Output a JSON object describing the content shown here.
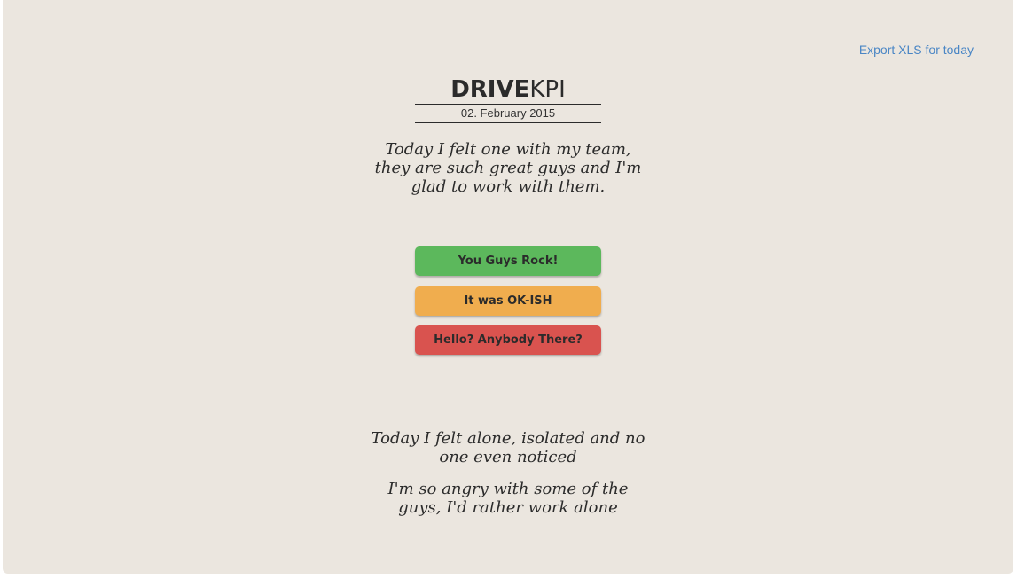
{
  "header": {
    "export_link": "Export XLS for today"
  },
  "brand": {
    "bold": "DRIVE",
    "light": "KPI"
  },
  "date": "02. February 2015",
  "quotes": {
    "top": "Today I felt one with my team, they are such great guys and I'm glad to work with them.",
    "middle": "Today I felt alone, isolated and no one even noticed",
    "bottom": "I'm so angry with some of the guys, I'd rather work alone"
  },
  "buttons": {
    "green": "You Guys Rock!",
    "orange": "It was OK-ISH",
    "red": "Hello? Anybody There?"
  },
  "colors": {
    "background": "#ebe6df",
    "link": "#4a86c5",
    "green": "#5cb85c",
    "orange": "#f0ad4e",
    "red": "#d9534f"
  }
}
